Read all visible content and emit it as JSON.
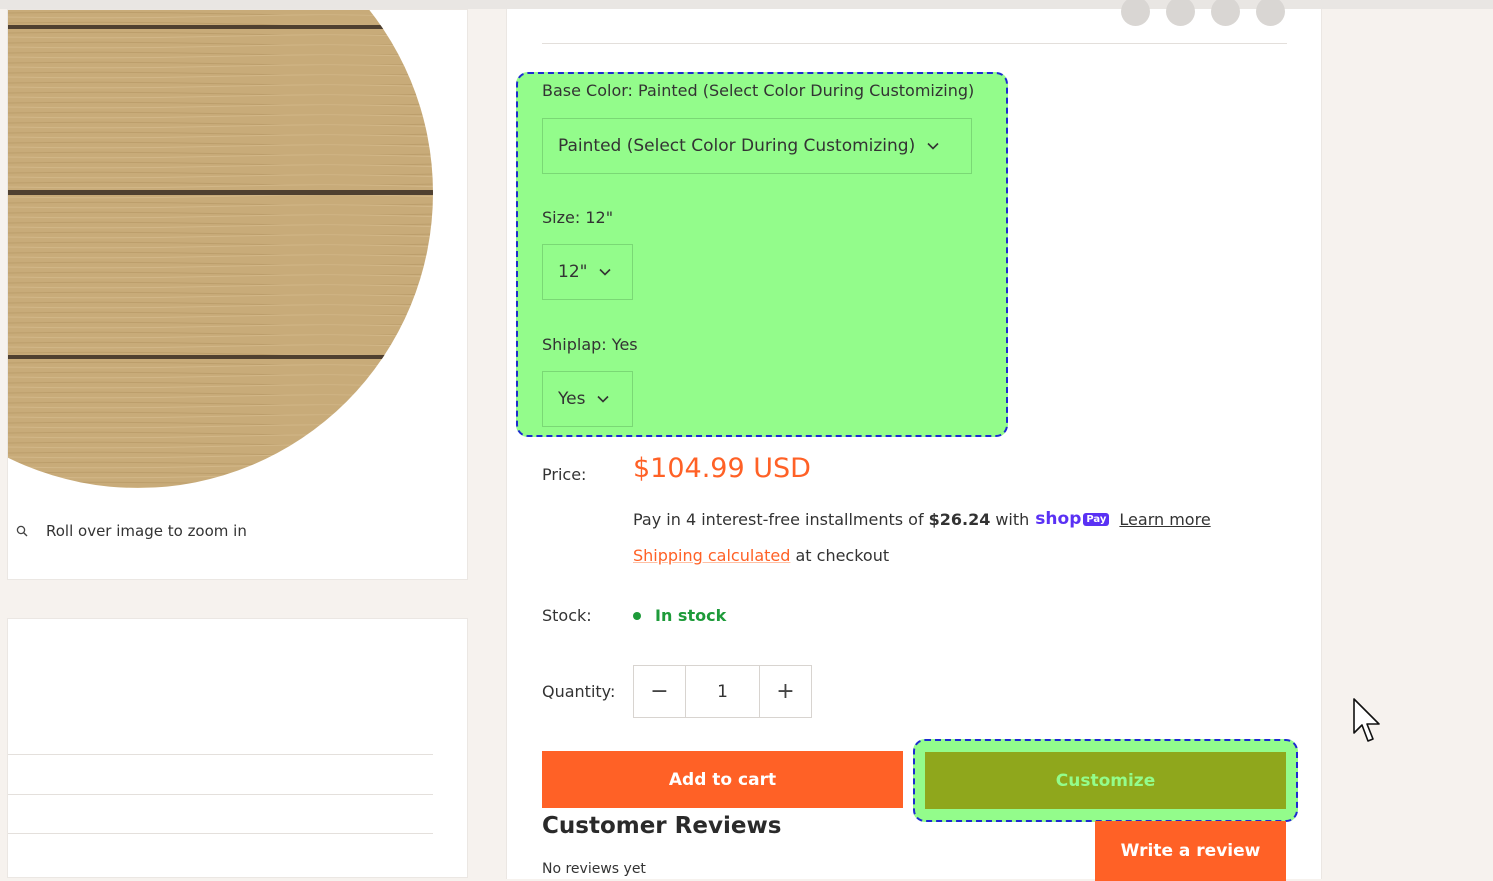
{
  "gallery": {
    "zoom_hint": "Roll over image to zoom in",
    "zoom_icon": "magnifier-icon"
  },
  "variants": {
    "base_color_label": "Base Color:",
    "base_color_value": "Painted (Select Color During Customizing)",
    "base_color_selected": "Painted (Select Color During Customizing)",
    "size_label": "Size:",
    "size_value": "12\"",
    "size_selected": "12\"",
    "shiplap_label": "Shiplap:",
    "shiplap_value": "Yes",
    "shiplap_selected": "Yes"
  },
  "price": {
    "label": "Price:",
    "value": "$104.99 USD"
  },
  "installments": {
    "prefix": "Pay in 4 interest-free installments of",
    "amount": "$26.24",
    "with": "with",
    "provider": "shop",
    "provider_badge": "Pay",
    "learn_more": "Learn more"
  },
  "shipping": {
    "link": "Shipping calculated",
    "suffix": " at checkout"
  },
  "stock": {
    "label": "Stock:",
    "value": "In stock"
  },
  "quantity": {
    "label": "Quantity:",
    "minus": "−",
    "value": "1",
    "plus": "+"
  },
  "buttons": {
    "add_to_cart": "Add to cart",
    "customize": "Customize",
    "write_review": "Write a review"
  },
  "reviews": {
    "title": "Customer Reviews",
    "subtitle": "No reviews yet"
  },
  "colors": {
    "accent": "#ff6126",
    "highlight": "#93fc8b",
    "customize": "#8fa71c",
    "in_stock": "#1e9b3a",
    "shop_pay": "#5a31f4"
  }
}
